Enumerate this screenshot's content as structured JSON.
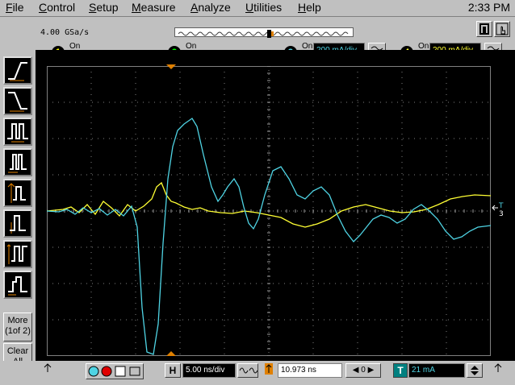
{
  "menu": [
    {
      "label": "File",
      "key": "F"
    },
    {
      "label": "Control",
      "key": "C"
    },
    {
      "label": "Setup",
      "key": "S"
    },
    {
      "label": "Measure",
      "key": "M"
    },
    {
      "label": "Analyze",
      "key": "A"
    },
    {
      "label": "Utilities",
      "key": "U"
    },
    {
      "label": "Help",
      "key": "H"
    }
  ],
  "clock": "2:33 PM",
  "sample_rate": "4.00 GSa/s",
  "channels": [
    {
      "num": "1",
      "on_label": "On",
      "checked": false,
      "color": "#ffff00"
    },
    {
      "num": "2",
      "on_label": "On",
      "checked": false,
      "color": "#00ff00"
    },
    {
      "num": "3",
      "on_label": "On",
      "checked": true,
      "scale": "200 mA/div",
      "color": "#4fd4e4"
    },
    {
      "num": "4",
      "on_label": "On",
      "checked": true,
      "scale": "200 mA/div",
      "color": "#ffff33"
    }
  ],
  "left_toolbar": {
    "more_label": "More",
    "more_sub": "(1of 2)",
    "clear_label": "Clear",
    "clear_sub": "All"
  },
  "bottom": {
    "h_label": "H",
    "timebase": "5.00 ns/div",
    "delay": "10.973 ns",
    "delay_zero": "0",
    "t_label": "T",
    "trigger_level": "21 mA"
  },
  "trace_colors": {
    "ch3": "#4fd4e4",
    "ch4": "#ffff33"
  }
}
